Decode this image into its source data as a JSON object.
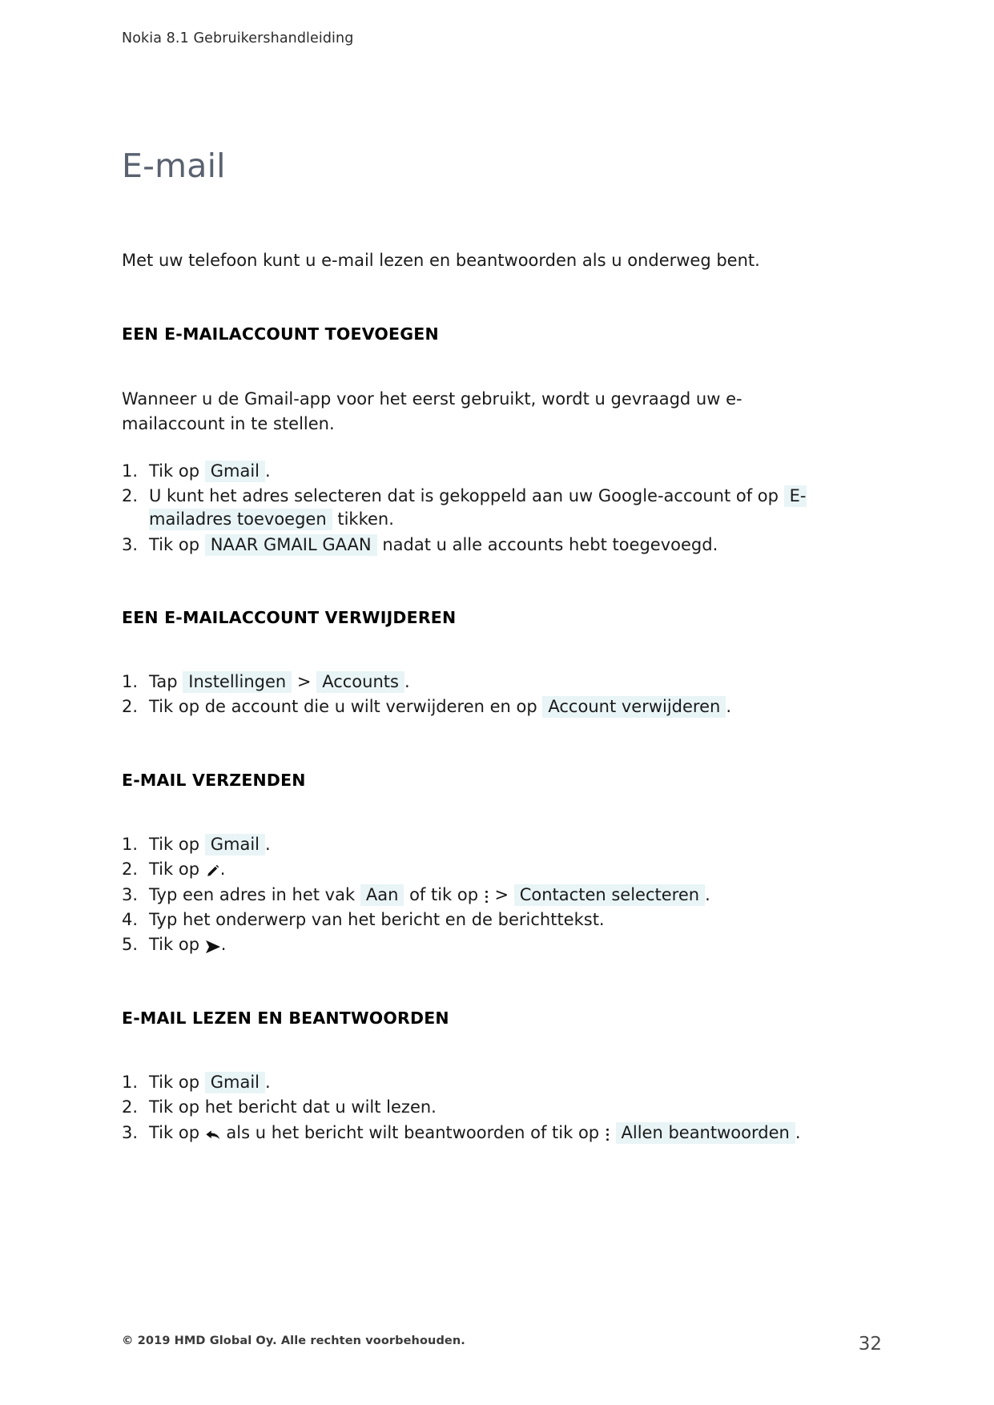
{
  "document": {
    "running_header": "Nokia 8.1 Gebruikershandleiding",
    "title": "E-mail",
    "intro": "Met uw telefoon kunt u e-mail lezen en beantwoorden als u onderweg bent."
  },
  "sections": [
    {
      "heading": "EEN E-MAILACCOUNT TOEVOEGEN",
      "paragraph": "Wanneer u de Gmail-app voor het eerst gebruikt, wordt u gevraagd uw e-mailaccount in te stellen.",
      "steps": [
        {
          "lead": "Tik op",
          "ui": "Gmail",
          "trail": "."
        },
        {
          "lead": "U kunt het adres selecteren dat is gekoppeld aan uw Google-account of op",
          "ui": "E-mailadres toevoegen",
          "trail": "tikken."
        },
        {
          "lead": "Tik op",
          "ui": "NAAR GMAIL GAAN",
          "trail": "nadat u alle accounts hebt toegevoegd."
        }
      ]
    },
    {
      "heading": "EEN E-MAILACCOUNT VERWIJDEREN",
      "steps": [
        {
          "lead": "Tap",
          "ui": "Instellingen",
          "sep": ">",
          "ui2": "Accounts",
          "trail": "."
        },
        {
          "lead": "Tik op de account die u wilt verwijderen en op",
          "ui": "Account verwijderen",
          "trail": "."
        }
      ]
    },
    {
      "heading": "E-MAIL VERZENDEN",
      "steps": [
        {
          "lead": "Tik op",
          "ui": "Gmail",
          "trail": "."
        },
        {
          "lead": "Tik op",
          "icon": "pencil-compose-icon",
          "trail": "."
        },
        {
          "lead": "Typ een adres in het vak",
          "ui": "Aan",
          "mid": "of tik op",
          "icon": "overflow-menu-icon",
          "sep": ">",
          "ui2": "Contacten selecteren",
          "trail": "."
        },
        {
          "lead": "Typ het onderwerp van het bericht en de berichttekst.",
          "trail": ""
        },
        {
          "lead": "Tik op",
          "icon": "send-icon",
          "trail": "."
        }
      ]
    },
    {
      "heading": "E-MAIL LEZEN EN BEANTWOORDEN",
      "steps": [
        {
          "lead": "Tik op",
          "ui": "Gmail",
          "trail": "."
        },
        {
          "lead": "Tik op het bericht dat u wilt lezen.",
          "trail": ""
        },
        {
          "lead": "Tik op",
          "icon": "reply-arrow-icon",
          "mid": "als u het bericht wilt beantwoorden of tik op",
          "icon2": "overflow-menu-icon",
          "ui2": "Allen beantwoorden",
          "trail": "."
        }
      ]
    }
  ],
  "footer": {
    "copyright": "© 2019 HMD Global Oy. Alle rechten voorbehouden.",
    "page_number": "32"
  },
  "colors": {
    "title": "#5a6270",
    "ui_highlight_bg": "#e8f4f6",
    "body_text": "#1a1a1a"
  }
}
